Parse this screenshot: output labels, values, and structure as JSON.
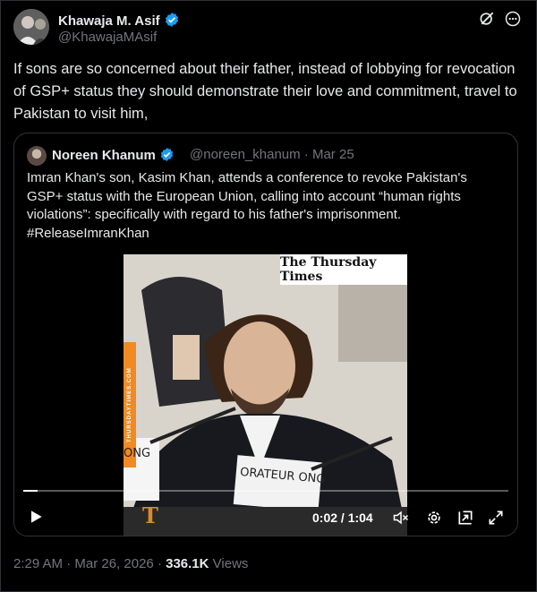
{
  "post": {
    "author_name": "Khawaja M. Asif",
    "author_handle": "@KhawajaMAsif",
    "text": "If sons are so concerned about their father, instead of lobbying for revocation of GSP+ status they should demonstrate their love and commitment, travel to Pakistan to visit him,",
    "timestamp": "2:29 AM · Mar 26, 2026",
    "views_count": "336.1K",
    "views_label": "Views",
    "icons": {
      "grok": "grok-icon",
      "more": "more-icon",
      "verified": "verified-badge-icon"
    }
  },
  "quote": {
    "author_name": "Noreen Khanum",
    "author_handle": "@noreen_khanum · Mar 25",
    "text": "Imran Khan's son, Kasim Khan, attends a conference to revoke Pakistan's GSP+ status with the European Union, calling into account “human rights violations”: specifically with regard to his father's imprisonment. #ReleaseImranKhan"
  },
  "video": {
    "watermark": "The Thursday Times",
    "side_label": "THURSDAYTIMES.COM",
    "nameplate_left": "ONG",
    "nameplate_right": "ORATEUR ONG",
    "time_display": "0:02 / 1:04",
    "progress": 0.03
  },
  "colors": {
    "background": "#000000",
    "text_primary": "#e7e9ea",
    "text_secondary": "#71767b",
    "border": "#2f3336",
    "verified": "#1d9bf0"
  }
}
